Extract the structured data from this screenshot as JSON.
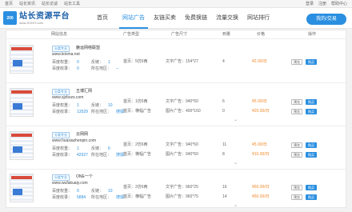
{
  "topbar": {
    "left": [
      "首页",
      "站长资讯",
      "站长访谈",
      "站长工具"
    ],
    "right": [
      "登录",
      "注册",
      "帮助中心"
    ]
  },
  "header": {
    "logo_mark": "200",
    "logo_name": "站长资源平台",
    "logo_url": "www.SOHO.com"
  },
  "nav": {
    "items": [
      "首页",
      "网站广告",
      "友链买卖",
      "免费换链",
      "流量交换",
      "网站排行"
    ],
    "active": 1,
    "post_label": "我的/交易"
  },
  "table": {
    "headers": [
      "网站信息",
      "广告类型",
      "广告尺寸",
      "到量",
      "价格",
      "操作"
    ]
  },
  "rows": [
    {
      "tag": "分类专业",
      "name": "魅运网络联盟",
      "url": "www.leixma.net",
      "weight_label": "百度权重：",
      "weight": "0",
      "sites_label": "反链：",
      "sites": "1",
      "index_label": "百度收录：",
      "index": "0",
      "region_label": "所在地区：",
      "region": "--",
      "type1": "首页：5仿6两",
      "size1": "文字广告：154*27",
      "amount1": "4",
      "price1": "¥2.00/日",
      "type2": "",
      "size2": "",
      "amount2": "",
      "price2": ""
    },
    {
      "tag": "分类专业",
      "name": "五博汇网",
      "url": "www.sjzbozs.com",
      "weight_label": "百度权重：",
      "weight": "1",
      "sites_label": "反链：",
      "sites": "10",
      "index_label": "百度收录：",
      "index": "13529",
      "region_label": "所在地区：",
      "region": "搜狐",
      "type1": "首页：1仿6两",
      "size1": "文字广告：940*60",
      "amount1": "6",
      "price1": "¥5.00/日",
      "type2": "首页：横幅广告",
      "size2": "图片广告：400*160",
      "amount2": "0",
      "price2": "¥20.00/日"
    },
    {
      "tag": "分类专业",
      "name": "云网网",
      "url": "www.huaxiazhenpin.com",
      "weight_label": "百度权重：",
      "weight": "1",
      "sites_label": "反链：",
      "sites": "6",
      "index_label": "百度收录：",
      "index": "42527",
      "region_label": "所在地区：",
      "region": "搜狐",
      "type1": "首页：2仿6两",
      "size1": "文字广告：940*60",
      "amount1": "11",
      "price1": "¥5.00/日",
      "type2": "首页：横幅广告",
      "size2": "图片广告：940*60",
      "amount2": "8",
      "price2": "¥10.00/日"
    },
    {
      "tag": "分类专业",
      "name": "ONE一个",
      "url": "www.wufakuaiy.com",
      "weight_label": "百度权重：",
      "weight": "0",
      "sites_label": "反链：",
      "sites": "10",
      "index_label": "百度收录：",
      "index": "5884",
      "region_label": "所在地区：",
      "region": "搜狐",
      "type1": "首页：2仿6两",
      "size1": "文字广告：960*25",
      "amount1": "16",
      "price1": "¥50.00/日",
      "type2": "首页：横幅广告",
      "size2": "图片广告：960*75",
      "amount2": "14",
      "price2": "¥50.00/日"
    }
  ],
  "buttons": {
    "preview": "预览",
    "buy": "购买"
  },
  "colors": {
    "accent": "#2a8fe0",
    "price": "#f08a2b"
  }
}
